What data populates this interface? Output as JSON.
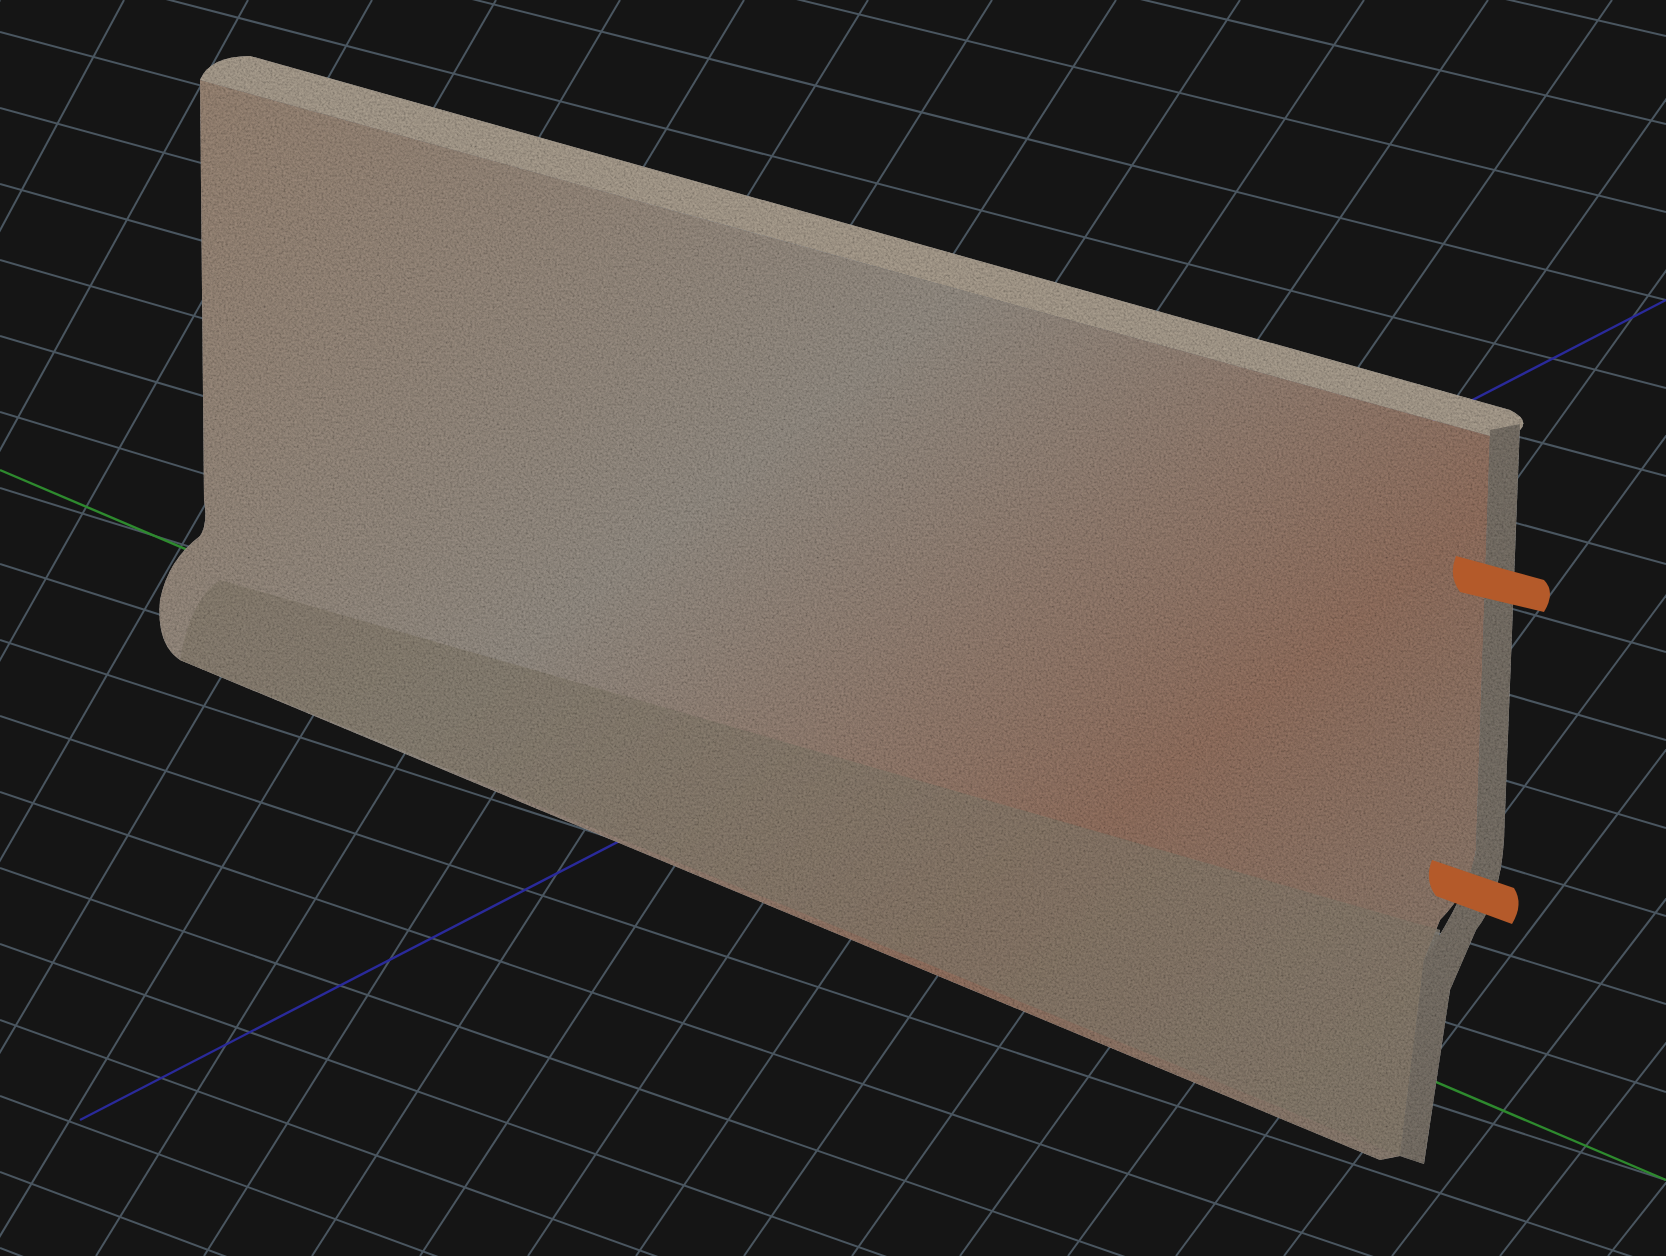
{
  "viewport": {
    "grid": true
  }
}
